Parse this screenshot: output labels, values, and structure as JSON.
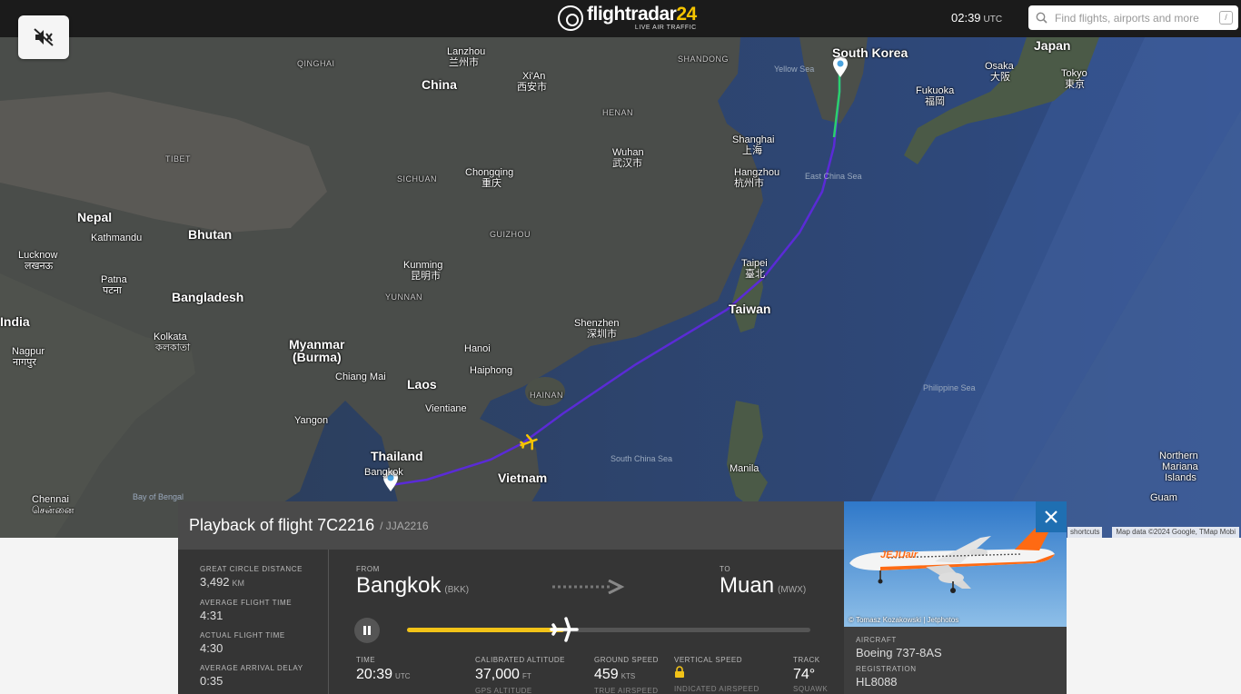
{
  "header": {
    "logo_name": "flightradar",
    "logo_num": "24",
    "logo_sub": "LIVE AIR TRAFFIC",
    "clock_time": "02:39",
    "clock_tz": "UTC",
    "search_placeholder": "Find flights, airports and more",
    "search_shortcut": "/"
  },
  "map": {
    "labels": {
      "china": "China",
      "lanzhou": "Lanzhou",
      "lanzhou_cn": "兰州市",
      "xian": "Xi'An",
      "xian_cn": "西安市",
      "qinghai": "QINGHAI",
      "shandong": "SHANDONG",
      "henan": "HENAN",
      "tibet": "TIBET",
      "sichuan": "SICHUAN",
      "wuhan": "Wuhan",
      "wuhan_cn": "武汉市",
      "chongqing": "Chongqing",
      "chongqing_cn": "重庆",
      "shanghai": "Shanghai",
      "shanghai_cn": "上海",
      "hangzhou": "Hangzhou",
      "hangzhou_cn": "杭州市",
      "south_korea": "South Korea",
      "japan": "Japan",
      "osaka": "Osaka",
      "osaka_cn": "大阪",
      "tokyo": "Tokyo",
      "tokyo_cn": "東京",
      "fukuoka": "Fukuoka",
      "fukuoka_cn": "福岡",
      "nepal": "Nepal",
      "kathmandu": "Kathmandu",
      "bhutan": "Bhutan",
      "lucknow": "Lucknow",
      "lucknow_hi": "लखनऊ",
      "patna": "Patna",
      "patna_hi": "पटना",
      "bangladesh": "Bangladesh",
      "india": "India",
      "kolkata": "Kolkata",
      "kolkata_hi": "কলকাতা",
      "nagpur": "Nagpur",
      "nagpur_hi": "नागपुर",
      "kunming": "Kunming",
      "kunming_cn": "昆明市",
      "guizhou": "GUIZHOU",
      "yunnan": "YUNNAN",
      "myanmar": "Myanmar",
      "burma": "(Burma)",
      "taipei": "Taipei",
      "taipei_cn": "臺北",
      "taiwan": "Taiwan",
      "shenzhen": "Shenzhen",
      "shenzhen_cn": "深圳市",
      "hanoi": "Hanoi",
      "haiphong": "Haiphong",
      "laos": "Laos",
      "hainan": "HAINAN",
      "vientiane": "Vientiane",
      "chiang_mai": "Chiang Mai",
      "yangon": "Yangon",
      "thailand": "Thailand",
      "bangkok": "Bangkok",
      "vietnam": "Vietnam",
      "chennai": "Chennai",
      "chennai_ta": "சென்னை",
      "manila": "Manila",
      "philippine_sea": "Philippine Sea",
      "south_china_sea": "South China Sea",
      "bay_of_bengal": "Bay of Bengal",
      "yellow_sea": "Yellow Sea",
      "east_china_sea": "East China Sea",
      "northern_mariana": "Northern",
      "northern_mariana2": "Mariana",
      "northern_mariana3": "Islands",
      "guam": "Guam"
    },
    "shortcuts": "shortcuts",
    "attribution": "Map data ©2024 Google, TMap Mobi"
  },
  "flight": {
    "title": "Playback of flight 7C2216",
    "callsign": "/ JJA2216",
    "stats": [
      {
        "label": "GREAT CIRCLE DISTANCE",
        "value": "3,492",
        "unit": "KM"
      },
      {
        "label": "AVERAGE FLIGHT TIME",
        "value": "4:31",
        "unit": ""
      },
      {
        "label": "ACTUAL FLIGHT TIME",
        "value": "4:30",
        "unit": ""
      },
      {
        "label": "AVERAGE ARRIVAL DELAY",
        "value": "0:35",
        "unit": ""
      }
    ],
    "from_label": "FROM",
    "from_city": "Bangkok",
    "from_code": "(BKK)",
    "to_label": "TO",
    "to_city": "Muan",
    "to_code": "(MWX)",
    "playback_progress": 0.39,
    "metrics": {
      "time_label": "TIME",
      "time_value": "20:39",
      "time_unit": "UTC",
      "cal_alt_label": "CALIBRATED ALTITUDE",
      "cal_alt_value": "37,000",
      "cal_alt_unit": "FT",
      "gps_alt_label": "GPS ALTITUDE",
      "gs_label": "GROUND SPEED",
      "gs_value": "459",
      "gs_unit": "KTS",
      "tas_label": "TRUE AIRSPEED",
      "vs_label": "VERTICAL SPEED",
      "ias_label": "INDICATED AIRSPEED",
      "track_label": "TRACK",
      "track_value": "74°",
      "squawk_label": "SQUAWK"
    }
  },
  "aircraft": {
    "photo_credit": "© Tomasz Kozakowski | Jetphotos",
    "livery_text": "JEJUair",
    "aircraft_label": "AIRCRAFT",
    "aircraft_value": "Boeing 737-8AS",
    "registration_label": "REGISTRATION",
    "registration_value": "HL8088"
  },
  "colors": {
    "brand_yellow": "#f5c400",
    "track_purple": "#5a2bd6",
    "close_blue": "#1f6fb2",
    "progress_yellow": "#f2c318"
  },
  "icons": [
    "mute-icon",
    "search-icon",
    "pause-icon",
    "airplane-icon",
    "close-icon",
    "lock-icon",
    "location-pin-icon"
  ]
}
